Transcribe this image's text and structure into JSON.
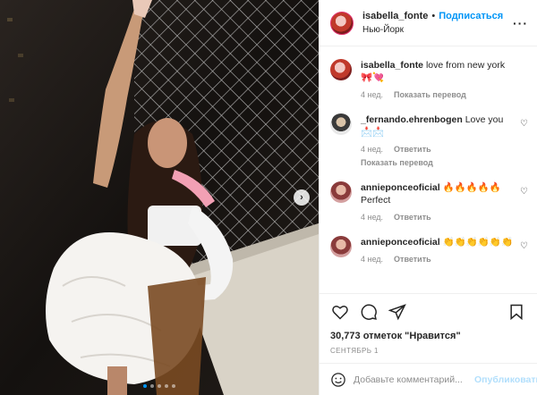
{
  "header": {
    "username": "isabella_fonte",
    "separator": "•",
    "follow_label": "Подписаться",
    "location": "Нью-Йорк",
    "more_label": "···"
  },
  "comments": [
    {
      "username": "isabella_fonte",
      "text": "love from new york🎀💘",
      "time": "4 нед.",
      "action": "Показать перевод"
    },
    {
      "username": "_fernando.ehrenbogen",
      "text": "Love you 📩📩",
      "time": "4 нед.",
      "action": "Ответить",
      "action2": "Показать перевод"
    },
    {
      "username": "annieponceoficial",
      "text": "🔥🔥🔥🔥🔥 Perfect",
      "time": "4 нед.",
      "action": "Ответить"
    },
    {
      "username": "annieponceoficial",
      "text": "👏👏👏👏👏👏",
      "time": "4 нед.",
      "action": "Ответить"
    }
  ],
  "likes": "30,773 отметок \"Нравится\"",
  "date": "СЕНТЯБРЬ 1",
  "add_comment": {
    "placeholder": "Добавьте комментарий...",
    "publish_label": "Опубликовать"
  },
  "carousel": {
    "next_label": "›",
    "slide_count": 5,
    "active_slide": 1
  },
  "colors": {
    "accent": "#0095f6",
    "publish_disabled": "#b2dffc",
    "text": "#262626",
    "muted": "#8e8e8e"
  }
}
